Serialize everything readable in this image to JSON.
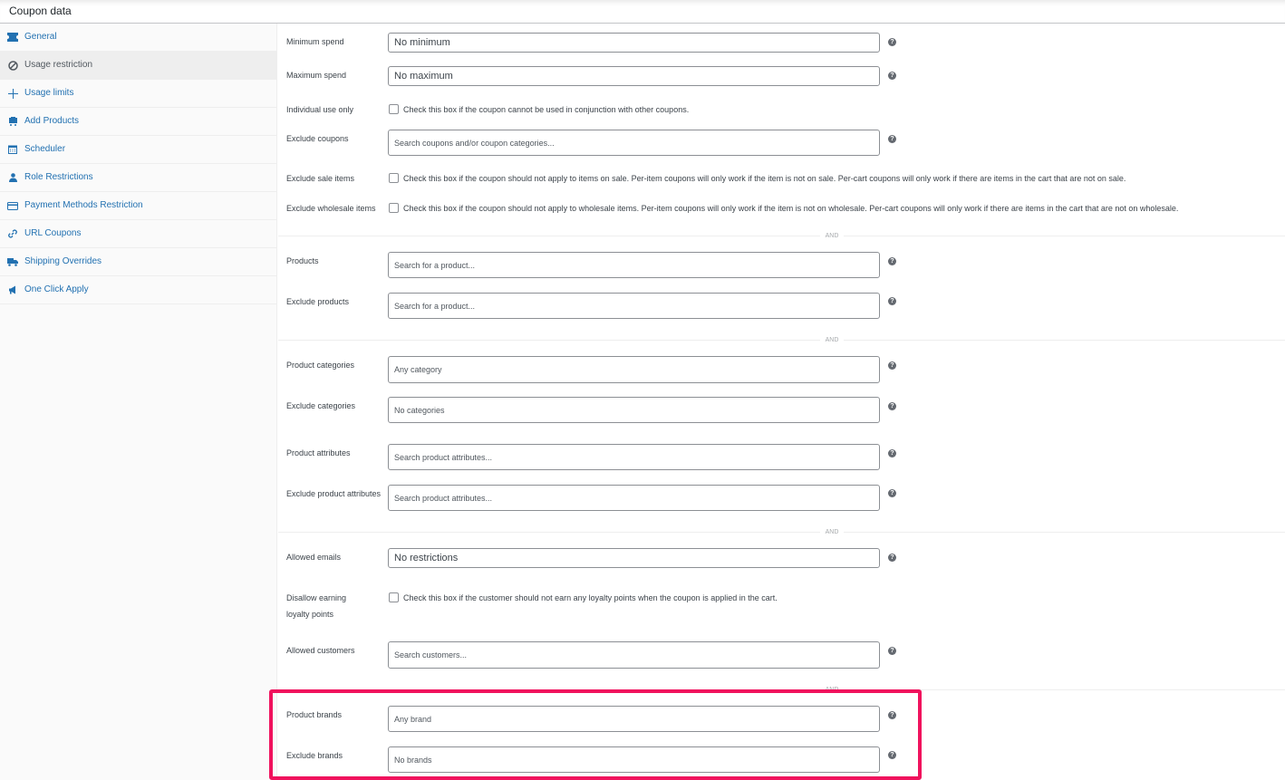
{
  "header": {
    "title": "Coupon data"
  },
  "sidebar": {
    "items": [
      {
        "label": "General",
        "icon": "ticket-icon",
        "active": false
      },
      {
        "label": "Usage restriction",
        "icon": "block-icon",
        "active": true
      },
      {
        "label": "Usage limits",
        "icon": "plus-icon",
        "active": false
      },
      {
        "label": "Add Products",
        "icon": "cart-icon",
        "active": false
      },
      {
        "label": "Scheduler",
        "icon": "calendar-icon",
        "active": false
      },
      {
        "label": "Role Restrictions",
        "icon": "user-icon",
        "active": false
      },
      {
        "label": "Payment Methods Restriction",
        "icon": "card-icon",
        "active": false
      },
      {
        "label": "URL Coupons",
        "icon": "link-icon",
        "active": false
      },
      {
        "label": "Shipping Overrides",
        "icon": "truck-icon",
        "active": false
      },
      {
        "label": "One Click Apply",
        "icon": "megaphone-icon",
        "active": false
      }
    ]
  },
  "form": {
    "min_spend": {
      "label": "Minimum spend",
      "placeholder": "No minimum"
    },
    "max_spend": {
      "label": "Maximum spend",
      "placeholder": "No maximum"
    },
    "individual_use": {
      "label": "Individual use only",
      "desc": "Check this box if the coupon cannot be used in conjunction with other coupons."
    },
    "exclude_coupons": {
      "label": "Exclude coupons",
      "placeholder": "Search coupons and/or coupon categories..."
    },
    "exclude_sale": {
      "label": "Exclude sale items",
      "desc": "Check this box if the coupon should not apply to items on sale. Per-item coupons will only work if the item is not on sale. Per-cart coupons will only work if there are items in the cart that are not on sale."
    },
    "exclude_wholesale": {
      "label": "Exclude wholesale items",
      "desc": "Check this box if the coupon should not apply to wholesale items. Per-item coupons will only work if the item is not on wholesale. Per-cart coupons will only work if there are items in the cart that are not on wholesale."
    },
    "and_label": "AND",
    "products": {
      "label": "Products",
      "placeholder": "Search for a product..."
    },
    "exclude_products": {
      "label": "Exclude products",
      "placeholder": "Search for a product..."
    },
    "product_categories": {
      "label": "Product categories",
      "placeholder": "Any category"
    },
    "exclude_categories": {
      "label": "Exclude categories",
      "placeholder": "No categories"
    },
    "product_attributes": {
      "label": "Product attributes",
      "placeholder": "Search product attributes..."
    },
    "exclude_product_attributes": {
      "label": "Exclude product attributes",
      "placeholder": "Search product attributes..."
    },
    "allowed_emails": {
      "label": "Allowed emails",
      "placeholder": "No restrictions"
    },
    "disallow_loyalty": {
      "label_line1": "Disallow earning",
      "label_line2": "loyalty points",
      "desc": "Check this box if the customer should not earn any loyalty points when the coupon is applied in the cart."
    },
    "allowed_customers": {
      "label": "Allowed customers",
      "placeholder": "Search customers..."
    },
    "product_brands": {
      "label": "Product brands",
      "placeholder": "Any brand"
    },
    "exclude_brands": {
      "label": "Exclude brands",
      "placeholder": "No brands"
    },
    "help_glyph": "?"
  },
  "colors": {
    "accent": "#2271b1",
    "highlight": "#f0125d"
  }
}
